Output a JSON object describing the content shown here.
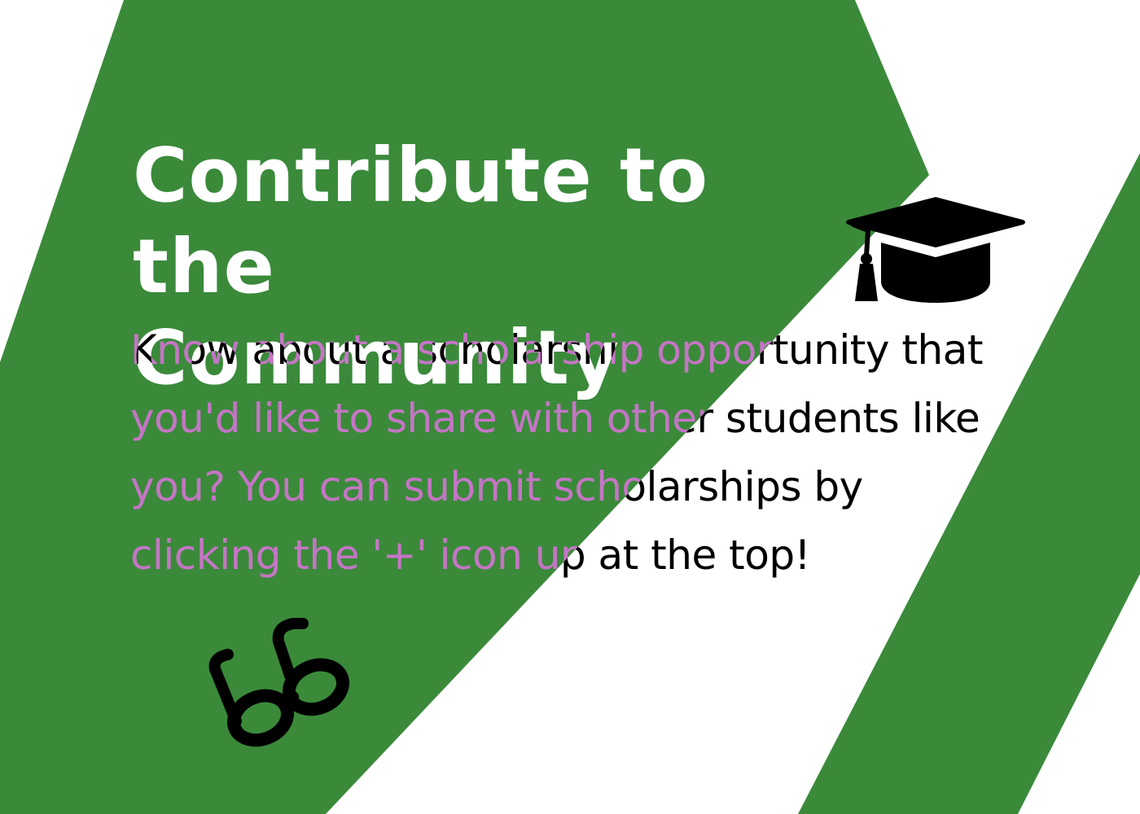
{
  "card": {
    "headline_line1": "Contribute to the",
    "headline_line2": "Community",
    "body": "Know about a scholarship opportunity that you'd like to share with other students like you? You can submit scholarships by clicking the '+' icon up at the top!"
  },
  "icons": {
    "top_right": "graduation-cap-icon",
    "bottom_left": "glasses-icon"
  },
  "colors": {
    "brand_green": "#3a8a3a",
    "background": "#ffffff",
    "headline": "#ffffff",
    "icon": "#000000"
  }
}
